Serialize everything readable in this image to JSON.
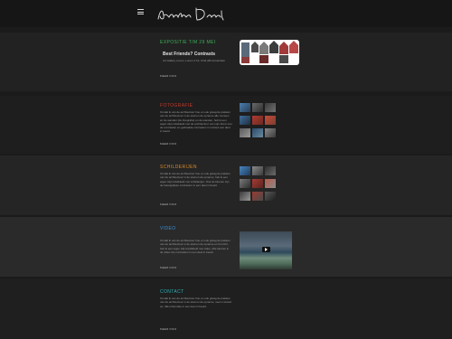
{
  "header": {
    "logo_text": "Angelique Dorh",
    "menu_icon": "hamburger-icon"
  },
  "sections": {
    "expo": {
      "title": "EXPOSITIE T/M 29 MEI",
      "title_color": "#3fae5a",
      "exhibition_name": "Best Friends? Contrasts",
      "info": "Art Gallery Lorem, Lorem 4 10, 1011 AB Amsterdam",
      "link": "MEER INFO"
    },
    "foto": {
      "title": "FOTOGRAFIE",
      "title_color": "#c0392b",
      "body": "Omdat ik van de architectuur hou en ook graag de plekken van de architectuur in de stad en de opname alle mensen en de wanden (de fotografie) en de wanden, heb ik een eigen stijl ontwikkeld met de architectuur van mijn foto's met de contrasten en gedraaide contrasten in ruimtes een deel in beeld.",
      "link": "MEER INFO"
    },
    "schilder": {
      "title": "SCHILDERIJEN",
      "title_color": "#d98a2b",
      "body": "Omdat ik van de architectuur hou en ook graag de plekken van de architectuur in de stad en de opname, heb ik een eigen stijl ontwikkeld met schilderijen. Ook de kleuren zijn de belangrijkste contrasten in een deel in beeld.",
      "link": "MEER INFO"
    },
    "video": {
      "title": "VIDEO",
      "title_color": "#3b8fd1",
      "body": "Omdat ik van de architectuur hou en ook graag de plekken van de architectuur in de stad en de opname en het licht, heb ik een eigen stijl ontwikkeld met video. Alle kleuren in de video zijn contrasten in een deel in beeld.",
      "link": "MEER INFO"
    },
    "contact": {
      "title": "CONTACT",
      "title_color": "#2bb1b8",
      "body": "Omdat ik van de architectuur hou en ook graag de plekken van de architectuur in de stad en de opname, neem contact op. Alle informatie in een deel in beeld.",
      "link": "MEER INFO"
    }
  }
}
